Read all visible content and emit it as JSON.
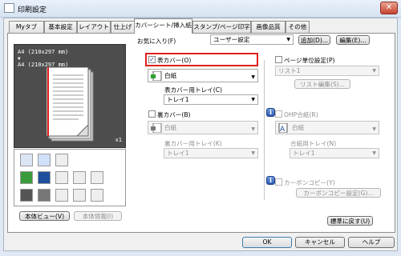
{
  "window": {
    "title": "印刷設定",
    "close": "✕"
  },
  "tabs": [
    "Myタブ",
    "基本設定",
    "レイアウト",
    "仕上げ",
    "カバーシート/挿入紙",
    "スタンプ/ページ印字",
    "画像品質",
    "その他"
  ],
  "favorites": {
    "label": "お気に入り(F)",
    "value": "ユーザー設定",
    "add": "追加(D)...",
    "edit": "編集(E)..."
  },
  "preview": {
    "line1": "A4 (210x297 mm)",
    "arrow": "▼",
    "line2": "A4 (210x297 mm)",
    "count": "x1"
  },
  "bottom_left": {
    "view_btn": "本体ビュー(V)",
    "info_btn": "本体情報(I)"
  },
  "front_cover": {
    "checkbox": "表カバー(O)",
    "checked": "✓",
    "paper": "白紙",
    "tray_label": "表カバー用トレイ(C)",
    "tray": "トレイ1"
  },
  "back_cover": {
    "checkbox": "裏カバー(B)",
    "paper": "白紙",
    "tray_label": "裏カバー用トレイ(K)",
    "tray": "トレイ1"
  },
  "per_page": {
    "checkbox": "ページ単位設定(P)",
    "list": "リスト1",
    "edit_list": "リスト編集(S)..."
  },
  "ohp": {
    "checkbox": "OHP合紙(R)",
    "paper": "白紙",
    "tray_label": "合紙用トレイ(N)",
    "tray": "トレイ1"
  },
  "carbon": {
    "checkbox": "カーボンコピー(Y)",
    "settings": "カーボンコピー設定(G)..."
  },
  "restore_btn": "標準に戻す(U)",
  "footer": {
    "ok": "OK",
    "cancel": "キャンセル",
    "help": "ヘルプ"
  },
  "colors": {
    "highlight": "#e0201e",
    "title_bg": "#dfe8f3",
    "preview_bg": "#4d4d4d"
  }
}
